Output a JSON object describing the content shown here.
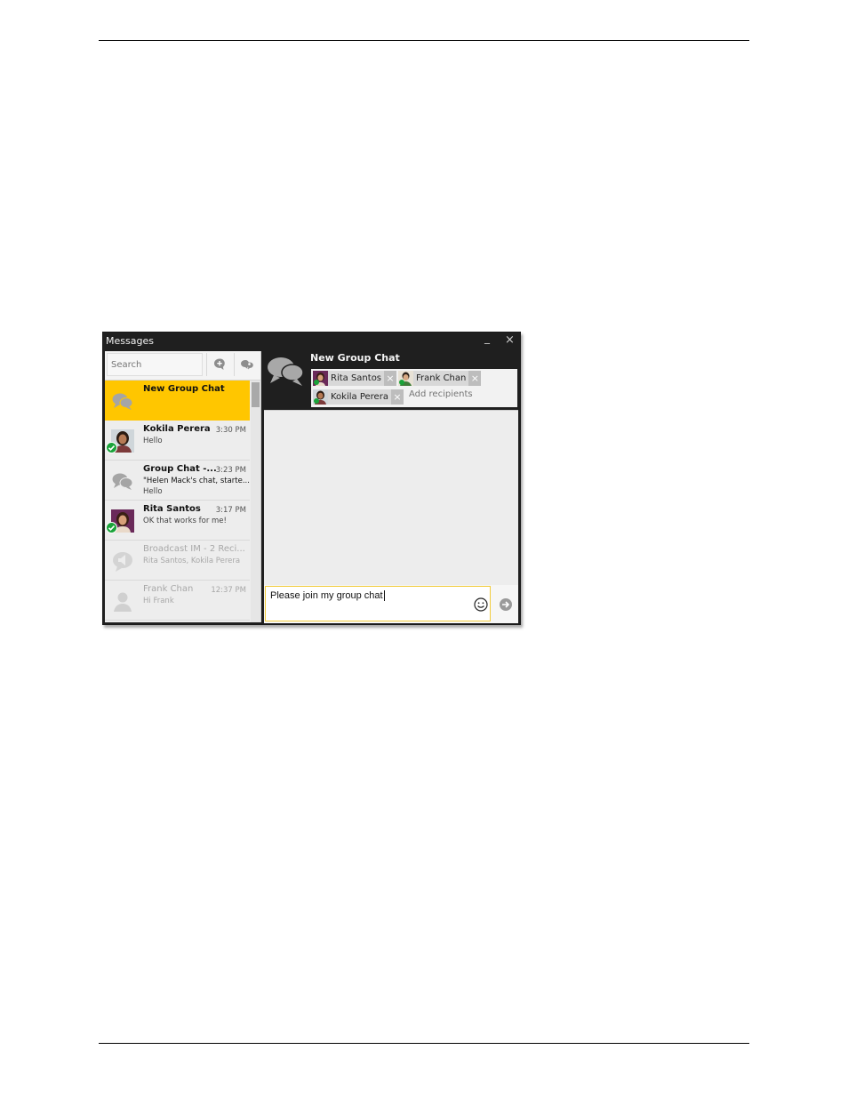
{
  "window": {
    "title": "Messages",
    "minimize_label": "_",
    "close_label": "×"
  },
  "search": {
    "placeholder": "Search"
  },
  "conversations": [
    {
      "name": "New Group Chat",
      "time": "",
      "preview": "",
      "preview2": "",
      "type": "group",
      "selected": true
    },
    {
      "name": "Kokila Perera",
      "time": "3:30 PM",
      "preview": "Hello",
      "preview2": "",
      "type": "person"
    },
    {
      "name": "Group Chat -...",
      "time": "3:23 PM",
      "preview": "\"Helen Mack's chat, starte...",
      "preview2": "Hello",
      "type": "group"
    },
    {
      "name": "Rita Santos",
      "time": "3:17 PM",
      "preview": "OK that works for me!",
      "preview2": "",
      "type": "person"
    },
    {
      "name": "Broadcast IM - 2 Reci...",
      "time": "",
      "preview": "Rita Santos, Kokila Perera",
      "preview2": "",
      "type": "broadcast",
      "dim": true
    },
    {
      "name": "Frank Chan",
      "time": "12:37 PM",
      "preview": "Hi Frank",
      "preview2": "",
      "type": "offline",
      "dim": true
    }
  ],
  "chat": {
    "title": "New Group Chat",
    "recipients": [
      "Rita Santos",
      "Frank Chan",
      "Kokila Perera"
    ],
    "remove_label": "×",
    "add_placeholder": "Add recipients"
  },
  "compose": {
    "text": "Please join my group chat"
  },
  "colors": {
    "accent": "#ffc600",
    "titlebar": "#1f1f1f",
    "status_available": "#1aa33a"
  }
}
